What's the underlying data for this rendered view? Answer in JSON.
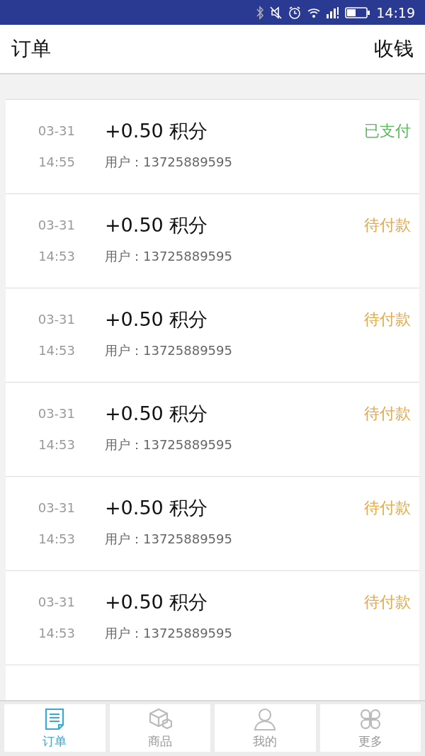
{
  "status_bar": {
    "time": "14:19"
  },
  "header": {
    "title": "订单",
    "action": "收钱"
  },
  "orders": [
    {
      "date": "03-31",
      "time": "14:55",
      "amount": "+0.50 积分",
      "user": "用户：13725889595",
      "status": "已支付",
      "kind": "paid"
    },
    {
      "date": "03-31",
      "time": "14:53",
      "amount": "+0.50 积分",
      "user": "用户：13725889595",
      "status": "待付款",
      "kind": "pending"
    },
    {
      "date": "03-31",
      "time": "14:53",
      "amount": "+0.50 积分",
      "user": "用户：13725889595",
      "status": "待付款",
      "kind": "pending"
    },
    {
      "date": "03-31",
      "time": "14:53",
      "amount": "+0.50 积分",
      "user": "用户：13725889595",
      "status": "待付款",
      "kind": "pending"
    },
    {
      "date": "03-31",
      "time": "14:53",
      "amount": "+0.50 积分",
      "user": "用户：13725889595",
      "status": "待付款",
      "kind": "pending"
    },
    {
      "date": "03-31",
      "time": "14:53",
      "amount": "+0.50 积分",
      "user": "用户：13725889595",
      "status": "待付款",
      "kind": "pending"
    }
  ],
  "tabs": [
    {
      "label": "订单",
      "selected": true
    },
    {
      "label": "商品",
      "selected": false
    },
    {
      "label": "我的",
      "selected": false
    },
    {
      "label": "更多",
      "selected": false
    }
  ]
}
